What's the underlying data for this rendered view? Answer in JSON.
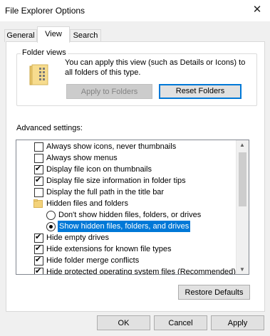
{
  "window": {
    "title": "File Explorer Options",
    "close_glyph": "✕"
  },
  "tabs": [
    {
      "label": "General",
      "active": false
    },
    {
      "label": "View",
      "active": true
    },
    {
      "label": "Search",
      "active": false
    }
  ],
  "folder_views": {
    "label": "Folder views",
    "description": "You can apply this view (such as Details or Icons) to all folders of this type.",
    "apply_button": "Apply to Folders",
    "reset_button": "Reset Folders"
  },
  "advanced": {
    "label": "Advanced settings:",
    "items": [
      {
        "type": "checkbox",
        "label": "Always show icons, never thumbnails",
        "checked": false
      },
      {
        "type": "checkbox",
        "label": "Always show menus",
        "checked": false
      },
      {
        "type": "checkbox",
        "label": "Display file icon on thumbnails",
        "checked": true
      },
      {
        "type": "checkbox",
        "label": "Display file size information in folder tips",
        "checked": true
      },
      {
        "type": "checkbox",
        "label": "Display the full path in the title bar",
        "checked": false
      },
      {
        "type": "folder",
        "label": "Hidden files and folders"
      },
      {
        "type": "radio",
        "label": "Don't show hidden files, folders, or drives",
        "checked": false
      },
      {
        "type": "radio",
        "label": "Show hidden files, folders, and drives",
        "checked": true,
        "selected": true
      },
      {
        "type": "checkbox",
        "label": "Hide empty drives",
        "checked": true
      },
      {
        "type": "checkbox",
        "label": "Hide extensions for known file types",
        "checked": true
      },
      {
        "type": "checkbox",
        "label": "Hide folder merge conflicts",
        "checked": true
      },
      {
        "type": "checkbox",
        "label": "Hide protected operating system files (Recommended)",
        "checked": true
      }
    ]
  },
  "restore_defaults_button": "Restore Defaults",
  "footer": {
    "ok": "OK",
    "cancel": "Cancel",
    "apply": "Apply"
  },
  "colors": {
    "accent": "#0078d7",
    "folder": "#f3d27a"
  }
}
